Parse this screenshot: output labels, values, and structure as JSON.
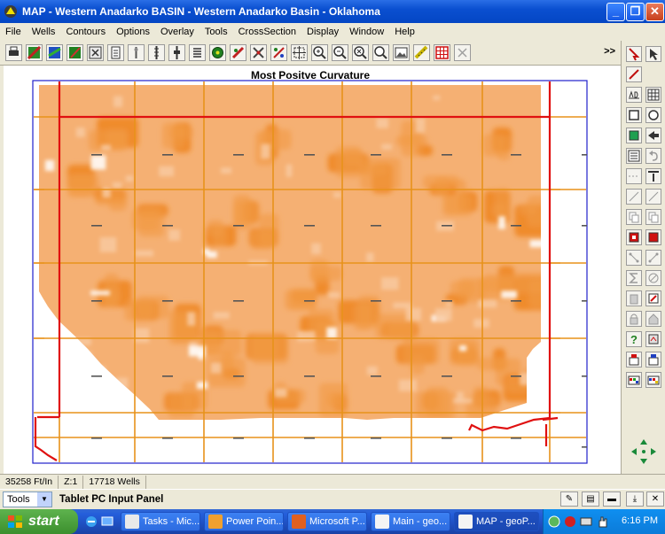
{
  "window": {
    "title": "MAP - Western Anadarko BASIN - Western Anadarko Basin - Oklahoma",
    "minimize_label": "_",
    "maximize_label": "❐",
    "close_label": "✕"
  },
  "menu": {
    "items": [
      "File",
      "Wells",
      "Contours",
      "Options",
      "Overlay",
      "Tools",
      "CrossSection",
      "Display",
      "Window",
      "Help"
    ]
  },
  "toolbar": {
    "more_label": ">>",
    "icons": [
      "print-icon",
      "map-color-icon",
      "map-color-2-icon",
      "map-color-3-icon",
      "grid-image-icon",
      "file-print-icon",
      "well-symbol-icon",
      "well-log-icon",
      "well-log-2-icon",
      "list-icon",
      "globe-icon",
      "fault-icon",
      "crossed-tools-icon",
      "wells-arrows-icon",
      "zoom-box-icon",
      "zoom-in-icon",
      "zoom-out-icon",
      "zoom-reset-icon",
      "image-icon",
      "ruler-icon",
      "grid-red-icon",
      "disabled-x-icon"
    ]
  },
  "map": {
    "title": "Most Positve Curvature",
    "palette": {
      "fill": "#f5b073",
      "blob_mid": "#f29a44",
      "blob_dark": "#ef8522",
      "grid_line": "#e8921a",
      "border_red": "#e01010",
      "frame_blue": "#2020cc",
      "light": "#f8c9a0",
      "white": "#ffffff"
    }
  },
  "status": {
    "scale": "35258 Ft/In",
    "zoom": "Z:1",
    "wells": "17718 Wells"
  },
  "tablet": {
    "tools_label": "Tools",
    "panel_title": "Tablet PC Input Panel"
  },
  "taskbar": {
    "start_label": "start",
    "tasks": [
      {
        "label": "Tasks - Mic...",
        "color": "#e9e9e9"
      },
      {
        "label": "Power Poin...",
        "color": "#f0a030"
      },
      {
        "label": "Microsoft P...",
        "color": "#e06020"
      },
      {
        "label": "Main - geo...",
        "color": "#f4f4f4"
      },
      {
        "label": "MAP - geoP...",
        "color": "#f4f4f4"
      }
    ],
    "clock": "6:16 PM"
  }
}
